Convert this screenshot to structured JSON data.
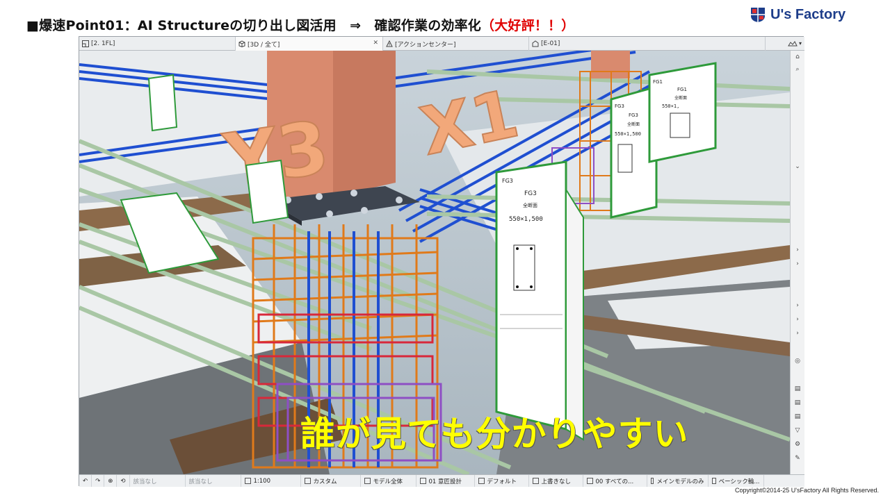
{
  "slide": {
    "title_main": "■爆速Point01：AI Structureの切り出し図活用　⇒　確認作業の効率化",
    "title_highlight": "（大好評！！）",
    "logo_text": "U's Factory",
    "caption": "誰が見ても分かりやすい",
    "copyright": "Copyright©2014-25  U'sFactory All Rights Reserved."
  },
  "window": {
    "tabs": [
      {
        "label": "[2. 1FL]",
        "icon": "floor-plan-icon"
      },
      {
        "label": "[3D / 全て]",
        "icon": "cube-icon",
        "active": true
      },
      {
        "label": "[アクションセンター]",
        "icon": "action-center-icon"
      },
      {
        "label": "[E-01]",
        "icon": "elevation-icon"
      }
    ],
    "tab_extra_icon": "layout-icon"
  },
  "scene": {
    "grid_labels": [
      "Y3",
      "X1"
    ],
    "section_sheets": [
      {
        "tag": "FG3",
        "title": "FG3",
        "subtitle": "全断面",
        "size": "550×1,500"
      },
      {
        "tag": "FG3",
        "title": "FG3",
        "subtitle": "全断面",
        "size": "550×1,500"
      },
      {
        "tag": "FG1",
        "title": "FG1",
        "subtitle": "全断面",
        "size": "550×1,"
      }
    ]
  },
  "statusbar": {
    "items": [
      {
        "label": "該当なし",
        "grey": true
      },
      {
        "label": "該当なし",
        "grey": true
      },
      {
        "label": "1:100"
      },
      {
        "label": "カスタム"
      },
      {
        "label": "モデル全体"
      },
      {
        "label": "01 意匠設計"
      },
      {
        "label": "デフォルト"
      },
      {
        "label": "上書きなし"
      },
      {
        "label": "00 すべての..."
      },
      {
        "label": "メインモデルのみ"
      },
      {
        "label": "ベーシック輪..."
      }
    ]
  },
  "colors": {
    "title_red": "#e00000",
    "caption_yellow": "#ffff00",
    "logo_blue": "#1d3d8a",
    "column": "#d98a6e",
    "rebar_orange": "#e07a1a",
    "rebar_red": "#d8283a",
    "rebar_blue": "#1f4fd1",
    "rebar_purple": "#8e4fc4",
    "pipe_green": "#a9c7a5"
  }
}
